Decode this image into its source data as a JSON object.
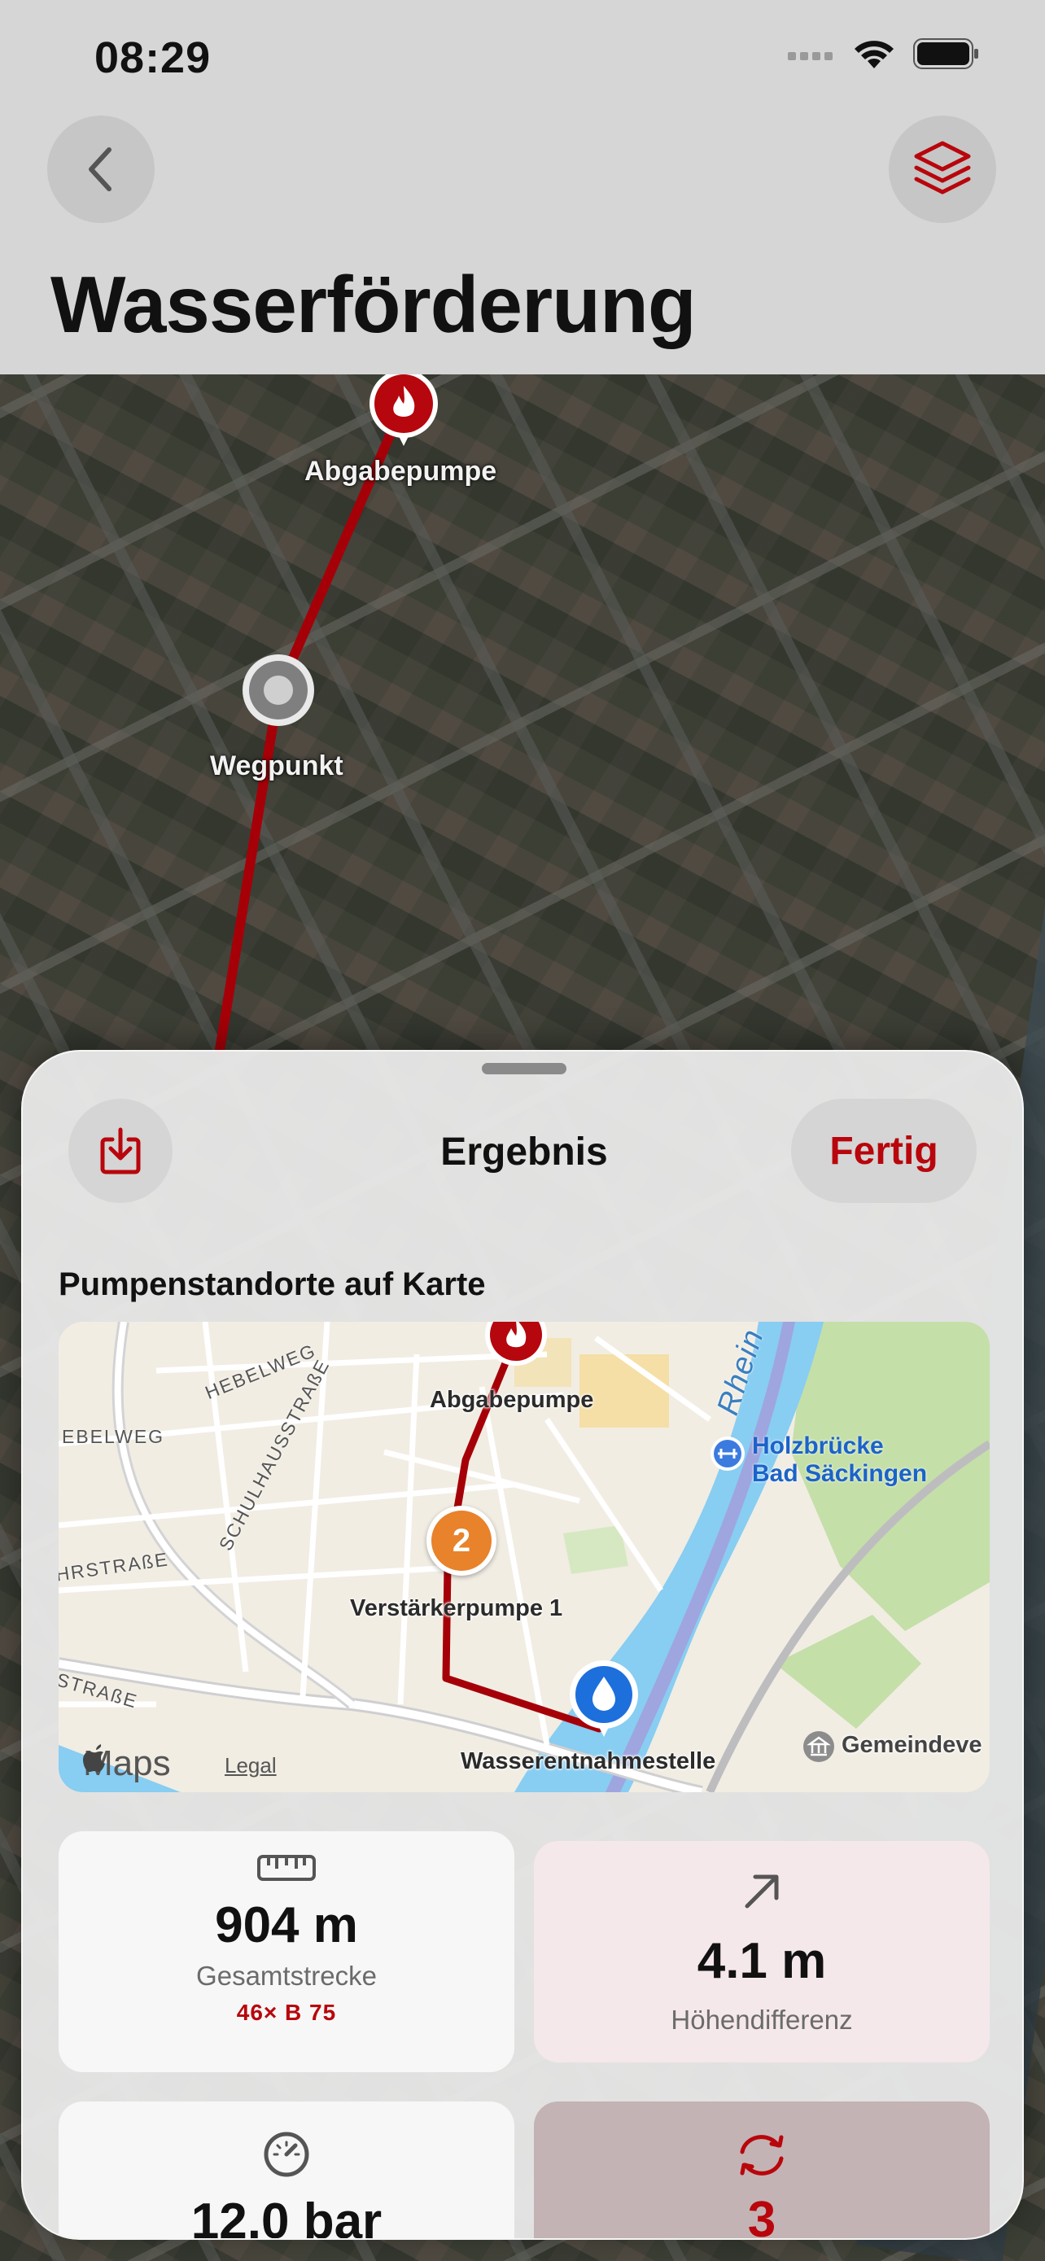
{
  "status_bar": {
    "time": "08:29"
  },
  "header": {
    "title": "Wasserförderung",
    "back_icon": "chevron-left-icon",
    "layers_icon": "layers-icon"
  },
  "satellite_map": {
    "pins": [
      {
        "name": "Abgabepumpe",
        "icon": "flame-icon"
      },
      {
        "name": "Wegpunkt",
        "icon": "circle-icon"
      }
    ]
  },
  "sheet": {
    "title": "Ergebnis",
    "done_label": "Fertig",
    "download_icon": "download-icon",
    "section_label": "Pumpenstandorte auf Karte",
    "map": {
      "pins": [
        {
          "label": "Abgabepumpe",
          "icon": "flame-icon"
        },
        {
          "label": "Verstärkerpumpe 1",
          "badge": "2"
        },
        {
          "label": "Wasserentnahmestelle",
          "icon": "water-drop-icon"
        }
      ],
      "streets": [
        "HEBELWEG",
        "EBELWEG",
        "SCHULHAUSSTRASSE",
        "HRSTRASSE",
        "STRASSE"
      ],
      "streets_display": [
        "HEBELWEG",
        "EBELWEG",
        "SCHULHAUSSTRAßE",
        "HRSTRAßE",
        "STRAßE"
      ],
      "river": "Rhein",
      "poi": {
        "line1": "Holzbrücke",
        "line2": "Bad Säckingen"
      },
      "poi_right": "Gemeindeve",
      "maps_brand": "Maps",
      "legal": "Legal"
    },
    "stats": [
      {
        "icon": "ruler-icon",
        "value": "904 m",
        "label": "Gesamtstrecke",
        "sub": "46× B 75"
      },
      {
        "icon": "arrow-up-right-icon",
        "value": "4.1 m",
        "label": "Höhendifferenz"
      },
      {
        "icon": "gauge-icon",
        "value": "12.0 bar"
      },
      {
        "icon": "refresh-icon",
        "value": "3"
      }
    ]
  },
  "colors": {
    "accent": "#b8060c",
    "route": "#a50008",
    "pump_orange": "#e8822b",
    "water_blue": "#1d6fdc"
  }
}
